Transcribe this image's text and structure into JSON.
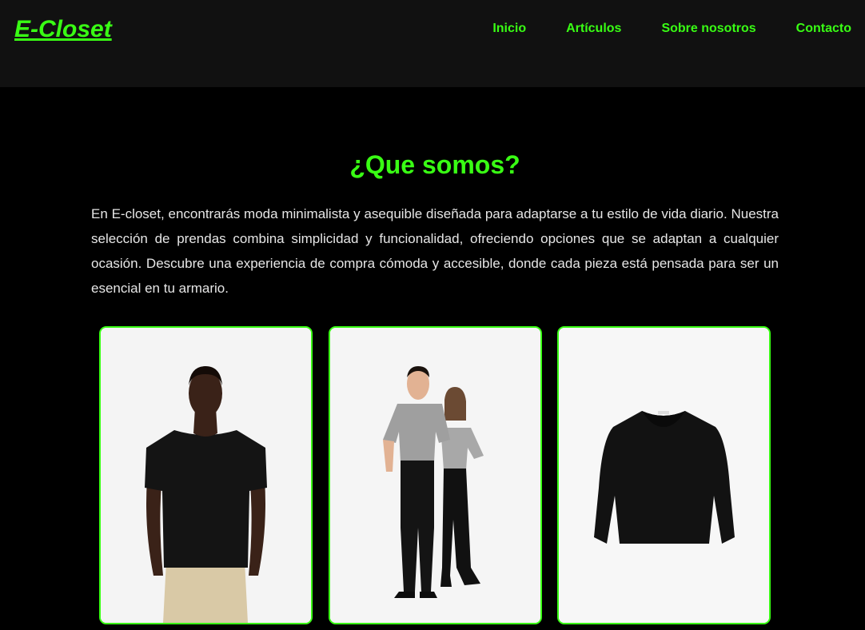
{
  "header": {
    "logo": "E-Closet",
    "nav": [
      {
        "label": "Inicio"
      },
      {
        "label": "Artículos"
      },
      {
        "label": "Sobre nosotros"
      },
      {
        "label": "Contacto"
      }
    ]
  },
  "about": {
    "title": "¿Que somos?",
    "description": "En E-closet, encontrarás moda minimalista y asequible diseñada para adaptarse a tu estilo de vida diario. Nuestra selección de prendas combina simplicidad y funcionalidad, ofreciendo opciones que se adaptan a cualquier ocasión. Descubre una experiencia de compra cómoda y accesible, donde cada pieza está pensada para ser un esencial en tu armario."
  },
  "products": [
    {
      "image": "man-black-tshirt-photo"
    },
    {
      "image": "couple-grey-tshirts-photo"
    },
    {
      "image": "black-sweater-photo"
    }
  ],
  "colors": {
    "accent": "#39ff14",
    "header_bg": "#111111",
    "page_bg": "#000000",
    "text": "#e6e6e6",
    "card_bg": "#f5f5f5"
  }
}
